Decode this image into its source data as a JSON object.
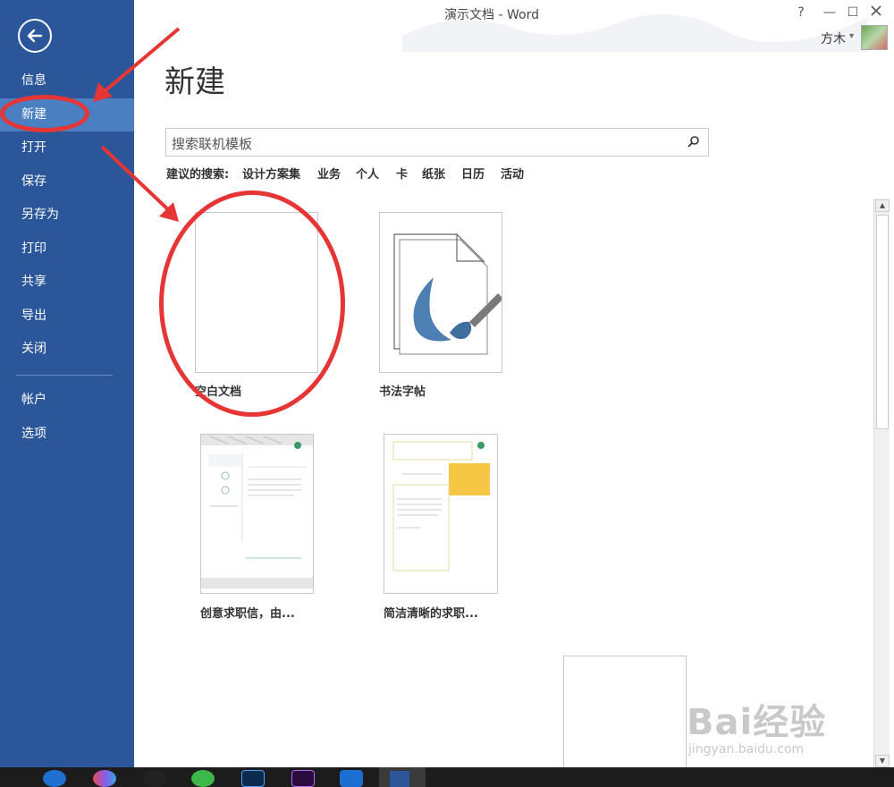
{
  "window": {
    "title": "演示文档 - Word",
    "help": "?",
    "minimize": "—",
    "maximize": "☐",
    "user": "方木",
    "user_caret": "▾"
  },
  "sidebar": {
    "items": [
      {
        "label": "信息"
      },
      {
        "label": "新建",
        "active": true
      },
      {
        "label": "打开"
      },
      {
        "label": "保存"
      },
      {
        "label": "另存为"
      },
      {
        "label": "打印"
      },
      {
        "label": "共享"
      },
      {
        "label": "导出"
      },
      {
        "label": "关闭"
      },
      {
        "label": "帐户"
      },
      {
        "label": "选项"
      }
    ]
  },
  "main": {
    "title": "新建",
    "search": {
      "placeholder": "搜索联机模板"
    },
    "suggested": {
      "label": "建议的搜索:",
      "links": [
        "设计方案集",
        "业务",
        "个人",
        "卡",
        "纸张",
        "日历",
        "活动"
      ]
    },
    "templates": [
      {
        "label": "空白文档"
      },
      {
        "label": "书法字帖"
      },
      {
        "label": "创意求职信，由..."
      },
      {
        "label": "简洁清晰的求职..."
      }
    ]
  },
  "watermark": {
    "main": "Bai经验",
    "sub": "jingyan.baidu.com"
  },
  "colors": {
    "sidebar": "#2b579a",
    "active": "#4a7fc1",
    "annotation": "#e63535"
  }
}
